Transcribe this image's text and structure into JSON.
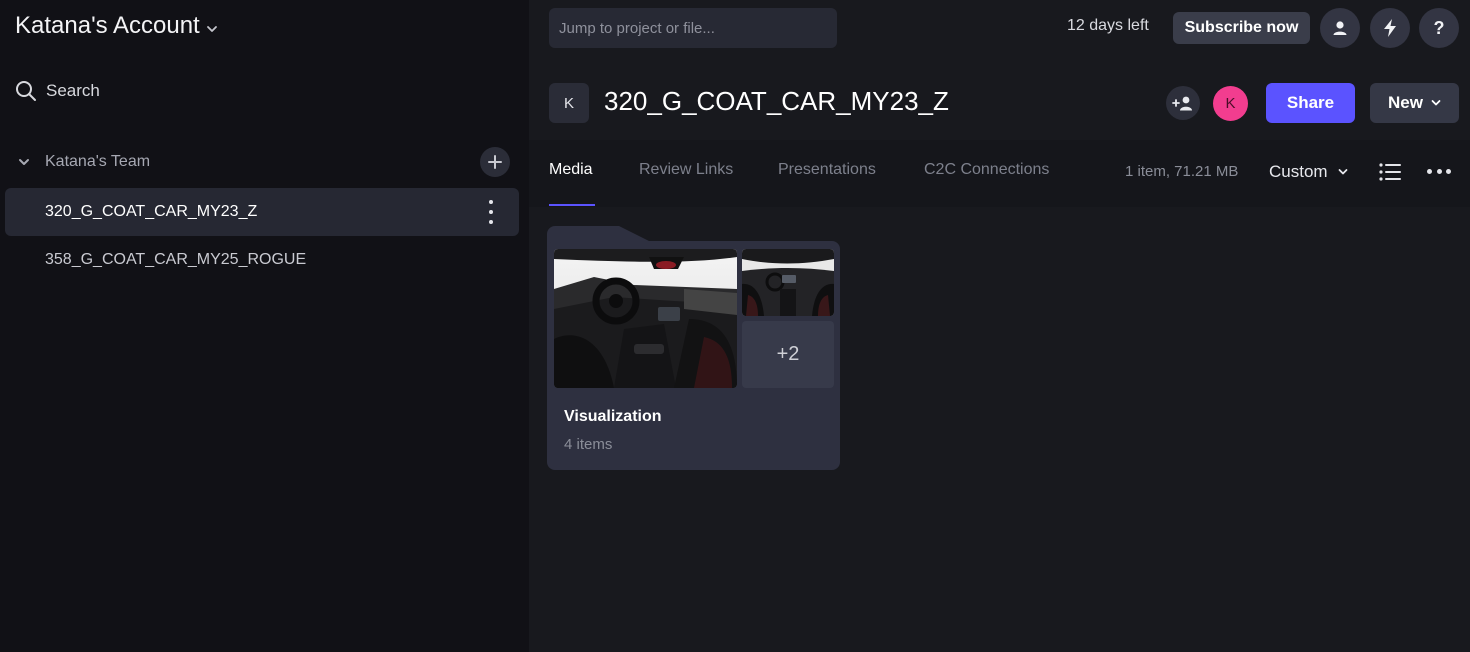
{
  "sidebar": {
    "account_name": "Katana's Account",
    "search_label": "Search",
    "team_name": "Katana's Team",
    "projects": [
      {
        "label": "320_G_COAT_CAR_MY23_Z",
        "active": true
      },
      {
        "label": "358_G_COAT_CAR_MY25_ROGUE",
        "active": false
      }
    ]
  },
  "topbar": {
    "jump_placeholder": "Jump to project or file...",
    "trial_text": "12 days left",
    "subscribe_label": "Subscribe now",
    "icons": [
      "user-icon",
      "lightning-icon",
      "help-icon"
    ],
    "help_glyph": "?"
  },
  "project": {
    "avatar_letter": "K",
    "title": "320_G_COAT_CAR_MY23_Z",
    "user_initial": "K",
    "share_label": "Share",
    "new_label": "New"
  },
  "tabs": [
    {
      "label": "Media",
      "active": true
    },
    {
      "label": "Review Links",
      "active": false
    },
    {
      "label": "Presentations",
      "active": false
    },
    {
      "label": "C2C Connections",
      "active": false
    }
  ],
  "toolbar": {
    "item_count": "1 item, 71.21 MB",
    "sort_label": "Custom"
  },
  "folder": {
    "name": "Visualization",
    "count": "4 items",
    "more_count": "+2"
  },
  "colors": {
    "accent": "#5b53ff",
    "sidebar_bg": "#111116",
    "main_bg": "#18191e",
    "card_bg": "#2e3040",
    "user_avatar": "#f23d8f"
  }
}
